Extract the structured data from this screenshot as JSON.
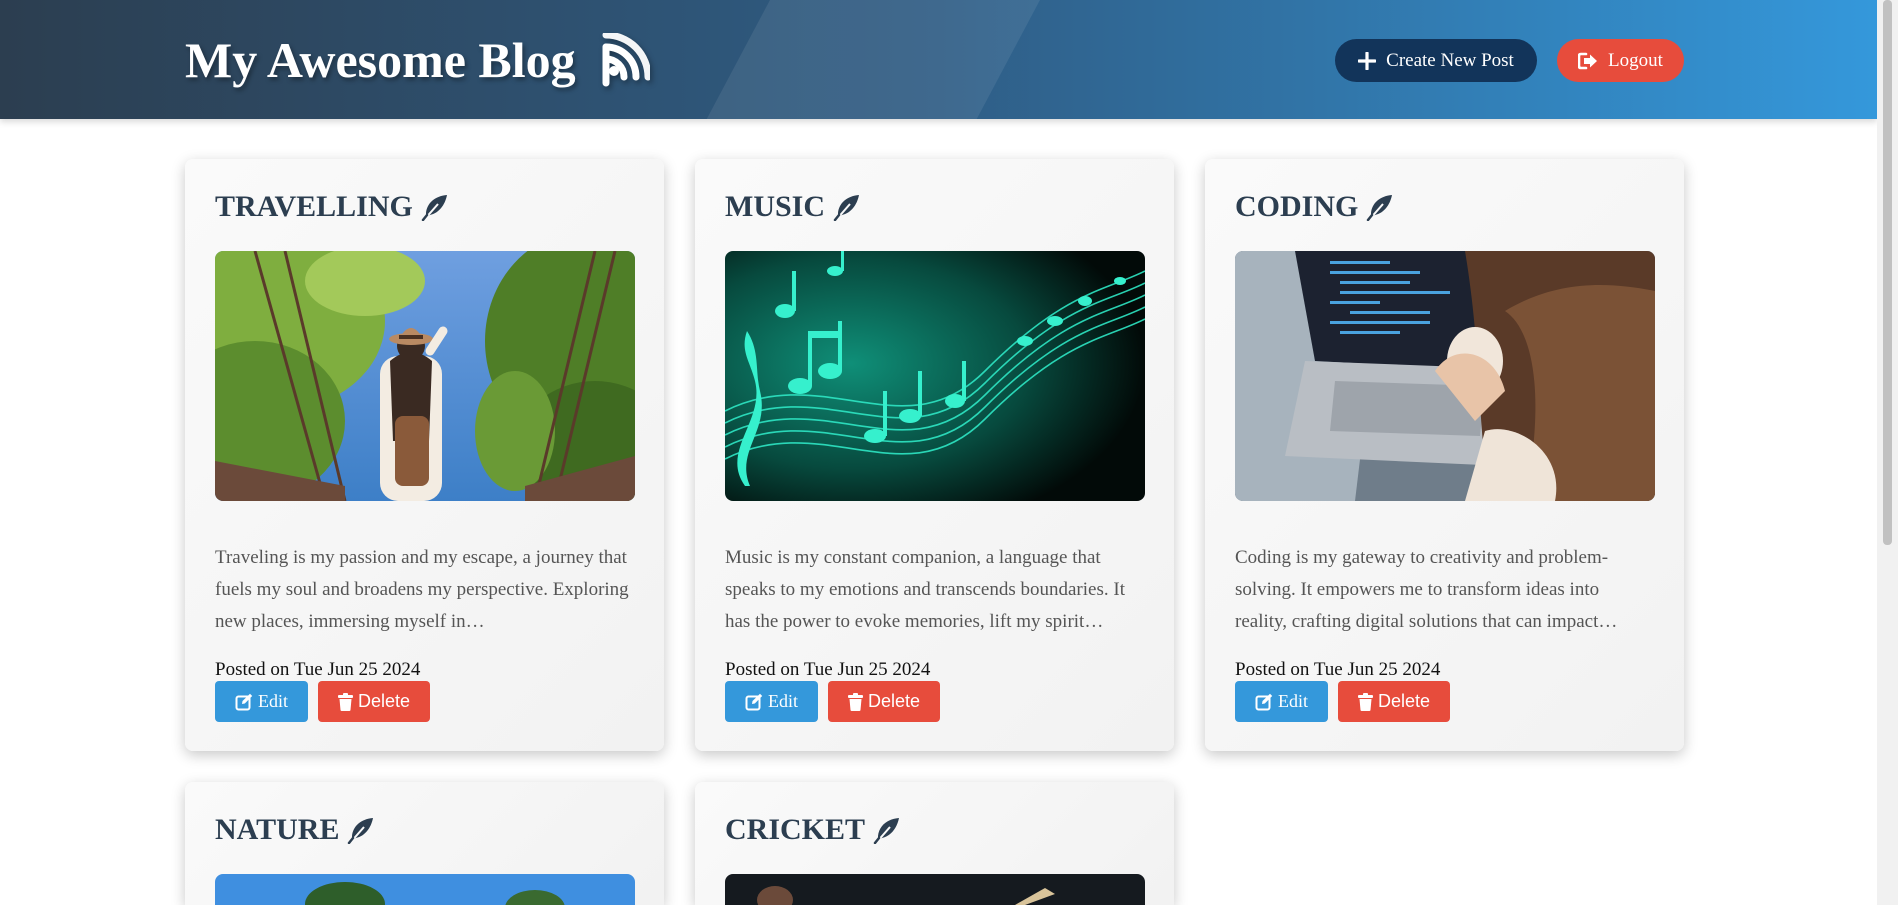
{
  "header": {
    "title": "My Awesome Blog",
    "create_label": "Create New Post",
    "logout_label": "Logout",
    "icons": [
      "rss-icon",
      "plus-icon",
      "sign-out-icon"
    ]
  },
  "posts": [
    {
      "title": "TRAVELLING",
      "image": "person-with-hat-on-rope-bridge",
      "excerpt": "Traveling is my passion and my escape, a journey that fuels my soul and broadens my perspective. Exploring new places, immersing myself in…",
      "date": "Posted on Tue Jun 25 2024",
      "edit_label": "Edit",
      "delete_label": "Delete"
    },
    {
      "title": "MUSIC",
      "image": "teal-music-notes-on-black",
      "excerpt": "Music is my constant companion, a language that speaks to my emotions and transcends boundaries. It has the power to evoke memories, lift my spirit…",
      "date": "Posted on Tue Jun 25 2024",
      "edit_label": "Edit",
      "delete_label": "Delete"
    },
    {
      "title": "CODING",
      "image": "person-with-laptop-and-coffee",
      "excerpt": "Coding is my gateway to creativity and problem-solving. It empowers me to transform ideas into reality, crafting digital solutions that can impact…",
      "date": "Posted on Tue Jun 25 2024",
      "edit_label": "Edit",
      "delete_label": "Delete"
    },
    {
      "title": "NATURE",
      "image": "trees-under-blue-sky"
    },
    {
      "title": "CRICKET",
      "image": "cricket-player-with-bat"
    }
  ],
  "colors": {
    "header_start": "#2c3e50",
    "header_end": "#3498db",
    "create_button": "#12345a",
    "logout_button": "#e74c3c",
    "edit_button": "#3498db",
    "delete_button": "#e74c3c",
    "card_title": "#2c3e50"
  }
}
